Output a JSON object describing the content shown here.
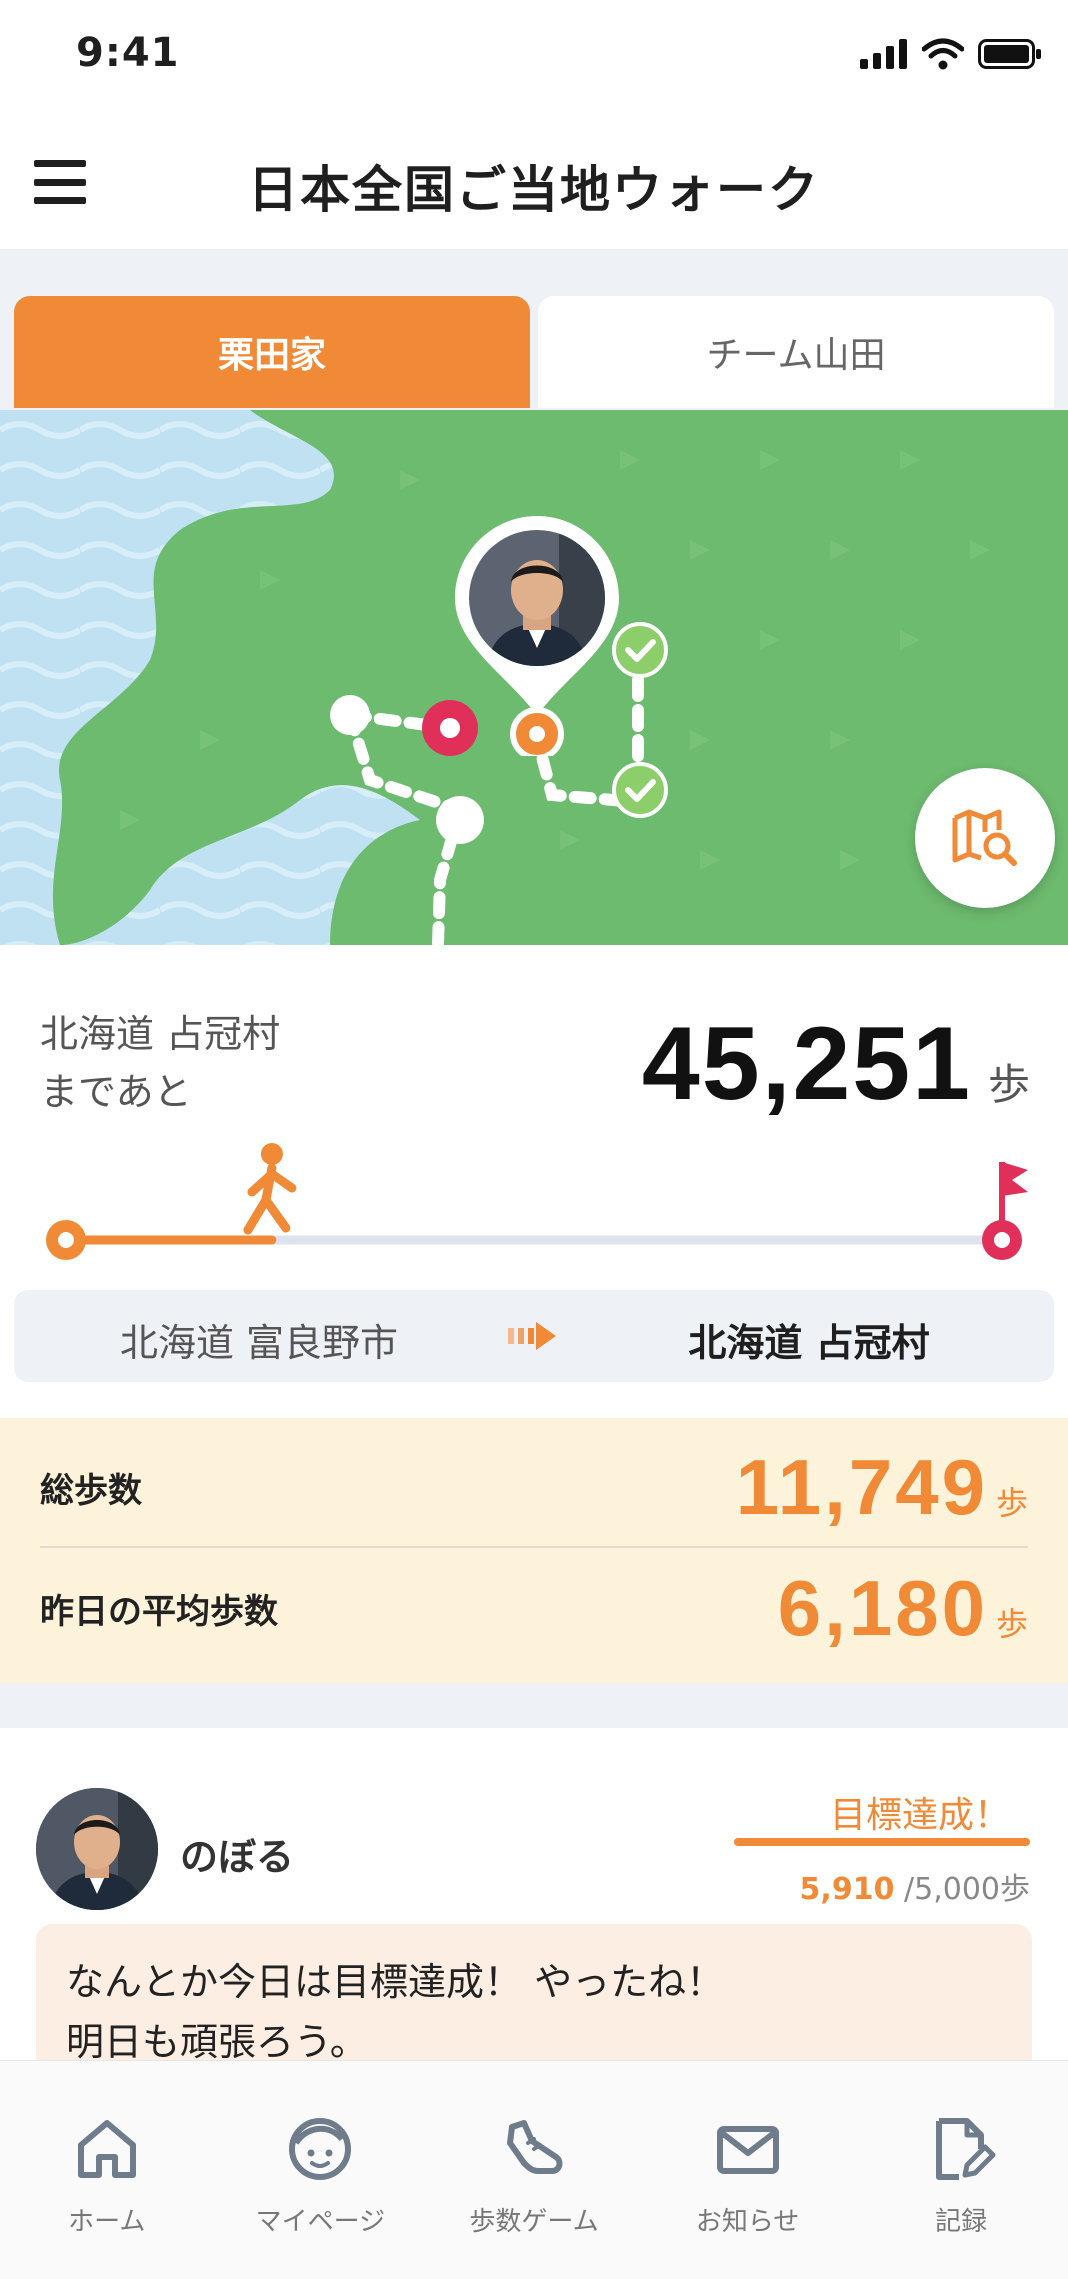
{
  "status_bar": {
    "time": "9:41",
    "icons": [
      "signal-icon",
      "wifi-icon",
      "battery-icon"
    ]
  },
  "header": {
    "title": "日本全国ご当地ウォーク",
    "menu_icon": "hamburger-menu-icon"
  },
  "tabs": [
    {
      "label": "栗田家",
      "active": true
    },
    {
      "label": "チーム山田",
      "active": false
    }
  ],
  "map": {
    "zoom_icon": "map-search-icon"
  },
  "progress": {
    "destination_line1": "北海道 占冠村",
    "destination_line2": "まであと",
    "remaining_steps": "45,251",
    "unit": "歩",
    "fraction_walked": 0.22
  },
  "route": {
    "from": "北海道 富良野市",
    "to": "北海道 占冠村"
  },
  "stats": {
    "total_label": "総歩数",
    "total_value": "11,749",
    "avg_label": "昨日の平均歩数",
    "avg_value": "6,180",
    "unit": "歩"
  },
  "feed": {
    "name": "のぼる",
    "goal_status": "目標達成！",
    "current_steps": "5,910",
    "goal_steps": "/5,000",
    "unit": "歩",
    "message_line1": "なんとか今日は目標達成！ やったね！",
    "message_line2": "明日も頑張ろう。"
  },
  "bottom_nav": [
    {
      "label": "ホーム",
      "icon": "home-icon"
    },
    {
      "label": "マイページ",
      "icon": "profile-face-icon"
    },
    {
      "label": "歩数ゲーム",
      "icon": "shoe-icon"
    },
    {
      "label": "お知らせ",
      "icon": "mail-icon"
    },
    {
      "label": "記録",
      "icon": "record-edit-icon"
    }
  ],
  "colors": {
    "accent": "#f08a36",
    "pin_red": "#e0305a",
    "check_green": "#8ccf6a",
    "map_land": "#6dbb6f",
    "map_sea": "#bfe1f2"
  }
}
